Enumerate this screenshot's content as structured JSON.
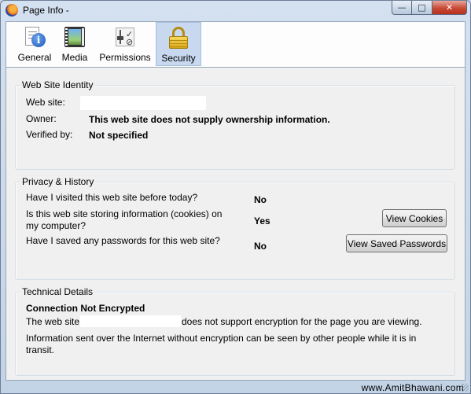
{
  "window": {
    "title": "Page Info -",
    "min_symbol": "—",
    "max_symbol": "□",
    "close_symbol": "✕"
  },
  "tabs": [
    {
      "label": "General",
      "icon": "info-icon"
    },
    {
      "label": "Media",
      "icon": "media-icon"
    },
    {
      "label": "Permissions",
      "icon": "permissions-icon"
    },
    {
      "label": "Security",
      "icon": "lock-icon",
      "selected": true
    }
  ],
  "identity": {
    "heading": "Web Site Identity",
    "website_label": "Web site:",
    "owner_label": "Owner:",
    "owner_value": "This web site does not supply ownership information.",
    "verified_label": "Verified by:",
    "verified_value": "Not specified"
  },
  "privacy": {
    "heading": "Privacy & History",
    "visited_q": "Have I visited this web site before today?",
    "visited_a": "No",
    "cookies_q_line1": "Is this web site storing information (cookies) on",
    "cookies_q_line2": "my computer?",
    "cookies_a": "Yes",
    "cookies_button": "View Cookies",
    "passwords_q": "Have I saved any passwords for this web site?",
    "passwords_a": "No",
    "passwords_button": "View Saved Passwords"
  },
  "technical": {
    "heading": "Technical Details",
    "status": "Connection Not Encrypted",
    "line1_prefix": "The web site",
    "line1_suffix": "does not support encryption for the page you are viewing.",
    "line2": "Information sent over the Internet without encryption can be seen by other people while it is in",
    "line3": "transit."
  },
  "watermark": "www.AmitBhawani.com",
  "colors": {
    "title_bar": "#c3d3e6",
    "selected_tab": "#c7d8ef",
    "close_button": "#c74a35"
  }
}
